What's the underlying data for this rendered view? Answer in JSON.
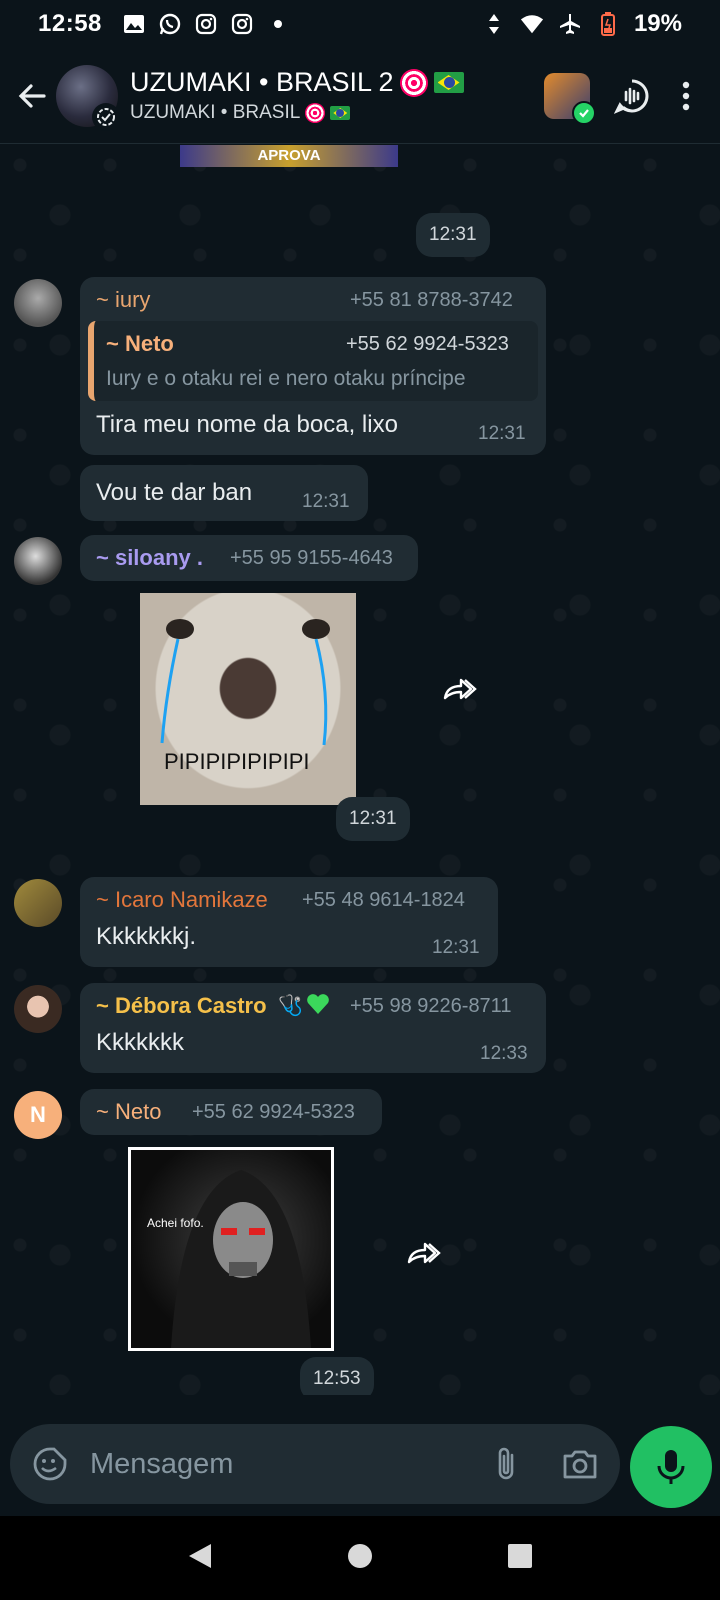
{
  "status_bar": {
    "time": "12:58",
    "battery": "19%"
  },
  "header": {
    "title": "UZUMAKI • BRASIL 2",
    "subtitle": "UZUMAKI • BRASIL"
  },
  "chat": {
    "top_image_text": "APROVA",
    "messages": [
      {
        "type": "time",
        "time": "12:31"
      },
      {
        "sender": "~ iury",
        "phone": "+55 81 8788-3742",
        "quote": {
          "sender": "~ Neto",
          "phone": "+55 62 9924-5323",
          "text": "Iury e o otaku rei e nero otaku príncipe"
        },
        "text": "Tira meu nome da boca, lixo",
        "time": "12:31"
      },
      {
        "text": "Vou te dar ban",
        "time": "12:31"
      },
      {
        "sender": "~ siloany .",
        "phone": "+55 95 9155-4643",
        "sticker_caption": "PIPIPIPIPIPIPI",
        "time": "12:31"
      },
      {
        "sender": "~ Icaro Namikaze",
        "phone": "+55 48 9614-1824",
        "text": "Kkkkkkkj.",
        "time": "12:31"
      },
      {
        "sender": "~ Débora Castro",
        "phone": "+55 98 9226-8711",
        "text": "Kkkkkkk",
        "time": "12:33"
      },
      {
        "sender": "~ Neto",
        "phone": "+55 62 9924-5323",
        "avatar_letter": "N",
        "sticker_caption": "Achei fofo.",
        "time": "12:53"
      }
    ]
  },
  "input": {
    "placeholder": "Mensagem"
  },
  "colors": {
    "background": "#0b141a",
    "bubble": "#202c33",
    "accent_green": "#21c063",
    "sender_iury": "#e8a56f",
    "sender_neto": "#f7b07b",
    "sender_siloany": "#a99bf0",
    "sender_icaro": "#e3763b",
    "sender_debora": "#f5c04a"
  },
  "icons": [
    "arrow-back-icon",
    "status-ring-icon",
    "voice-chat-icon",
    "more-vert-icon",
    "forward-icon",
    "emoji-sticker-icon",
    "attach-icon",
    "camera-icon",
    "mic-icon",
    "nav-back-icon",
    "nav-home-icon",
    "nav-recents-icon"
  ]
}
